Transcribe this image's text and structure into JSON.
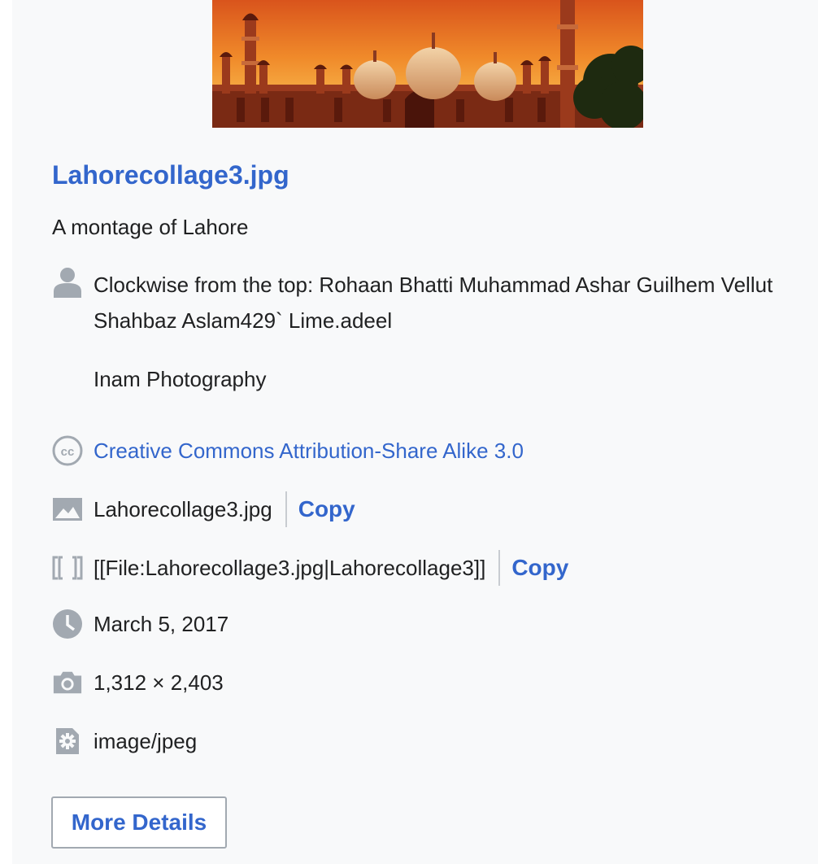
{
  "file": {
    "title": "Lahorecollage3.jpg",
    "description": "A montage of Lahore",
    "author_line": "Clockwise from the top: Rohaan Bhatti Muhammad Ashar Guilhem Vellut Shahbaz Aslam429` Lime.adeel",
    "author_extra": "Inam Photography",
    "license": "Creative Commons Attribution-Share Alike 3.0",
    "filename": "Lahorecollage3.jpg",
    "wikitext": "[[File:Lahorecollage3.jpg|Lahorecollage3]]",
    "date": "March 5, 2017",
    "dimensions": "1,312 × 2,403",
    "mime": "image/jpeg"
  },
  "actions": {
    "copy_label": "Copy",
    "more_details": "More Details"
  },
  "icons": {
    "author": "user-icon",
    "license": "creative-commons-icon",
    "filename": "image-icon",
    "wikitext": "wikitext-brackets-icon",
    "date": "clock-icon",
    "dimensions": "camera-icon",
    "mime": "settings-icon"
  },
  "colors": {
    "link": "#3366cc",
    "icon": "#a2a9b1",
    "panel_bg": "#f8f9fa"
  }
}
